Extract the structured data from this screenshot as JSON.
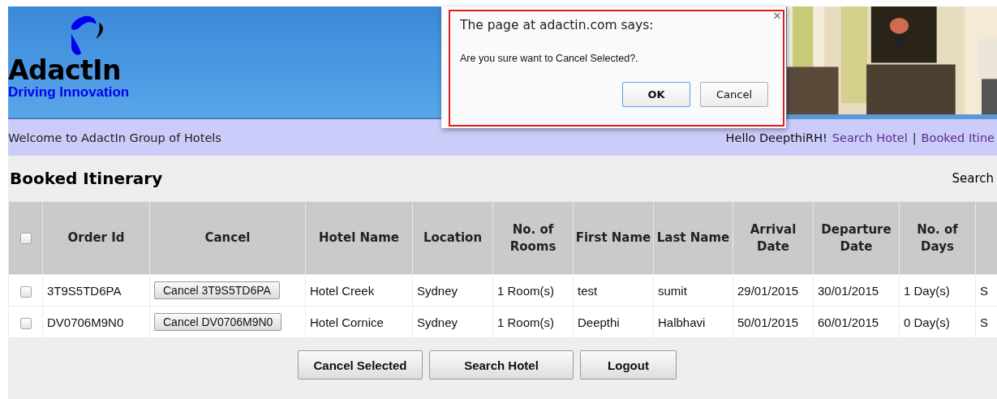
{
  "header": {
    "logo_name": "AdactIn",
    "logo_tagline": "Driving Innovation"
  },
  "nav": {
    "welcome": "Welcome to AdactIn Group of Hotels",
    "greeting": "Hello DeepthiRH!",
    "links": [
      "Search Hotel",
      "Booked Itine"
    ],
    "separator": "|"
  },
  "page_title": "Booked Itinerary",
  "search_label": "Search",
  "table": {
    "select_all_checked": false,
    "columns": [
      "Order Id",
      "Cancel",
      "Hotel Name",
      "Location",
      "No. of Rooms",
      "First Name",
      "Last Name",
      "Arrival Date",
      "Departure Date",
      "No. of Days"
    ],
    "rows": [
      {
        "checked": false,
        "order_id": "3T9S5TD6PA",
        "cancel_button": "Cancel 3T9S5TD6PA",
        "hotel_name": "Hotel Creek",
        "location": "Sydney",
        "rooms": "1 Room(s)",
        "first_name": "test",
        "last_name": "sumit",
        "arrival": "29/01/2015",
        "departure": "30/01/2015",
        "days": "1 Day(s)",
        "column_11": "S"
      },
      {
        "checked": false,
        "order_id": "DV0706M9N0",
        "cancel_button": "Cancel DV0706M9N0",
        "hotel_name": "Hotel Cornice",
        "location": "Sydney",
        "rooms": "1 Room(s)",
        "first_name": "Deepthi",
        "last_name": "Halbhavi",
        "arrival": "50/01/2015",
        "departure": "60/01/2015",
        "days": "0 Day(s)",
        "column_11": "S"
      }
    ]
  },
  "buttons": [
    "Cancel Selected",
    "Search Hotel",
    "Logout"
  ],
  "dialog": {
    "title": "The page at adactin.com says:",
    "message": "Are you sure want to Cancel Selected?.",
    "close": "×",
    "buttons": [
      {
        "label": "OK",
        "default": true
      },
      {
        "label": "Cancel",
        "default": false
      }
    ]
  }
}
